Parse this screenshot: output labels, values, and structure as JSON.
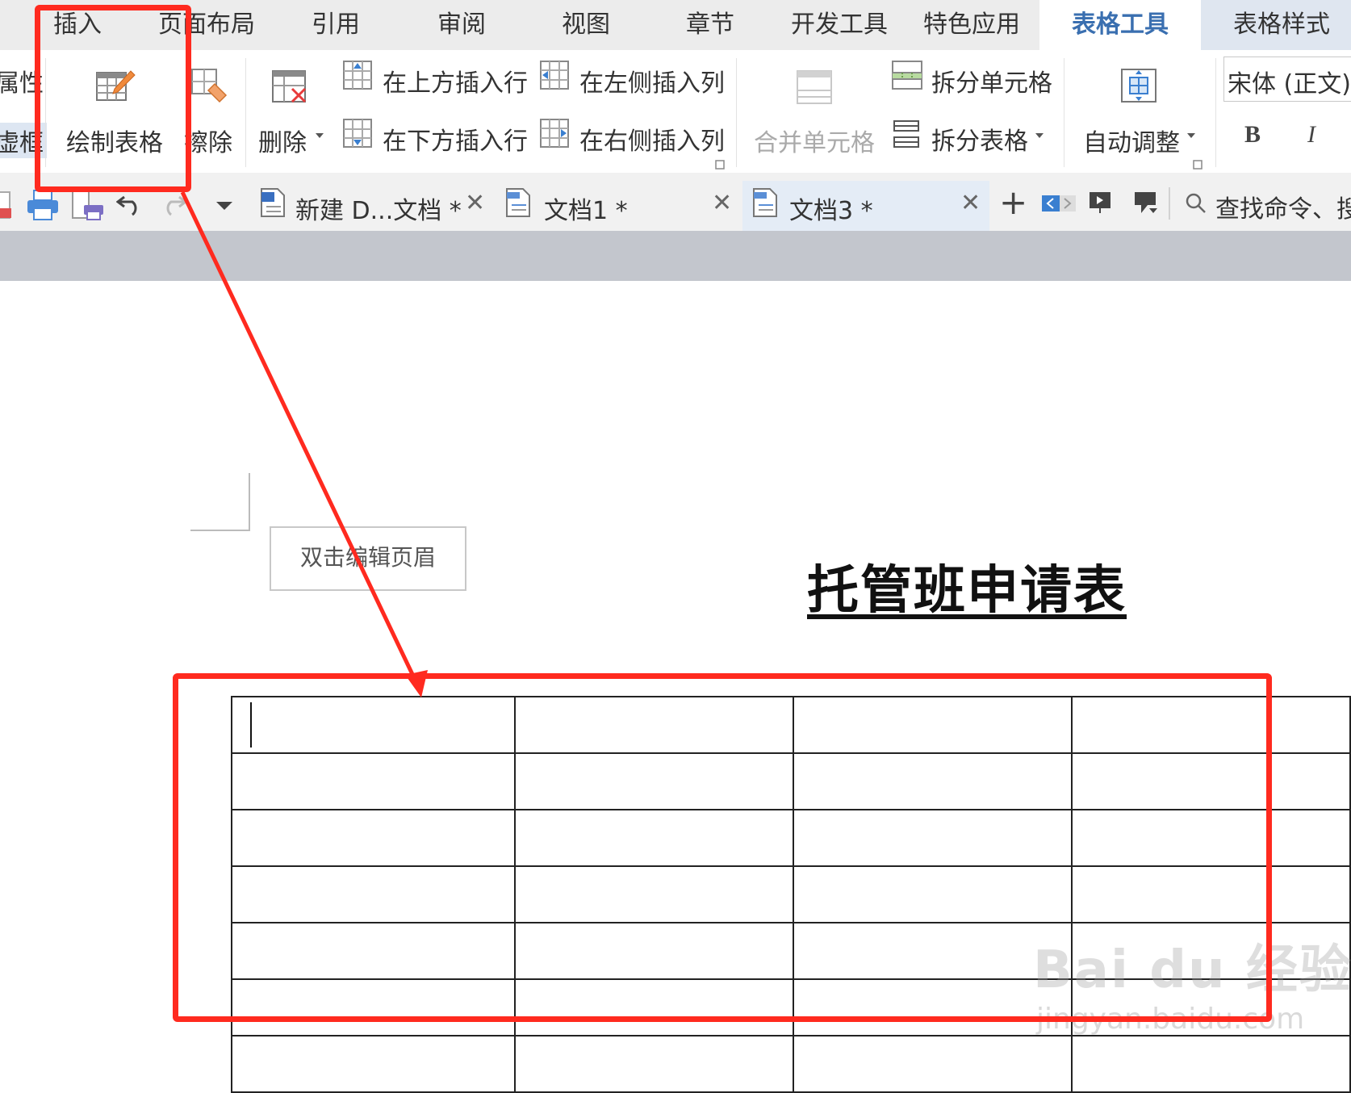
{
  "menu": {
    "tabs": [
      "插入",
      "页面布局",
      "引用",
      "审阅",
      "视图",
      "章节",
      "开发工具",
      "特色应用",
      "表格工具",
      "表格样式"
    ],
    "active_tab": "表格工具"
  },
  "ribbon": {
    "left_partial_top": "属性",
    "left_partial_bottom": "虚框",
    "draw_table": "绘制表格",
    "erase": "擦除",
    "delete": "删除",
    "insert_row_above": "在上方插入行",
    "insert_row_below": "在下方插入行",
    "insert_col_left": "在左侧插入列",
    "insert_col_right": "在右侧插入列",
    "merge_cells": "合并单元格",
    "split_cells": "拆分单元格",
    "split_table": "拆分表格",
    "auto_fit": "自动调整",
    "font_name": "宋体 (正文)",
    "bold": "B",
    "italic": "I"
  },
  "doc_tabs": [
    {
      "label": "新建 D...文档 *"
    },
    {
      "label": "文档1 *"
    },
    {
      "label": "文档3 *"
    }
  ],
  "search": {
    "placeholder": "查找命令、搜"
  },
  "document": {
    "header_hint": "双击编辑页眉",
    "title": "托管班申请表"
  },
  "watermark": {
    "logo": "Bai du 经验",
    "url": "jingyan.baidu.com"
  },
  "colors": {
    "highlight": "#ff2a1f",
    "active_tab_text": "#3a6fb0",
    "gutter": "#c3c6cd"
  }
}
